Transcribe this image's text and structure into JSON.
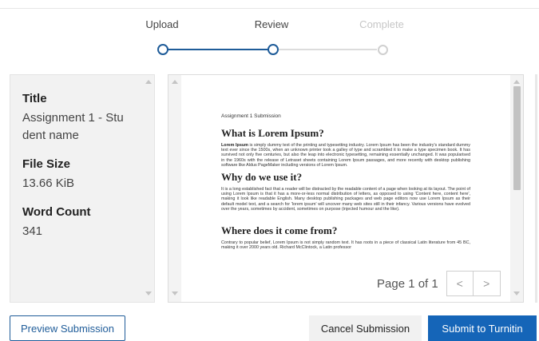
{
  "steps": [
    {
      "label": "Upload",
      "state": "done"
    },
    {
      "label": "Review",
      "state": "current"
    },
    {
      "label": "Complete",
      "state": "todo"
    }
  ],
  "info": {
    "title_label": "Title",
    "title_value": "Assignment 1 - Student name",
    "size_label": "File Size",
    "size_value": "13.66 KiB",
    "words_label": "Word Count",
    "words_value": "341"
  },
  "document": {
    "header": "Assignment 1 Submission",
    "h1": "What is Lorem Ipsum?",
    "p1_bold": "Lorem Ipsum",
    "p1": " is simply dummy text of the printing and typesetting industry. Lorem Ipsum has been the industry's standard dummy text ever since the 1500s, when an unknown printer took a galley of type and scrambled it to make a type specimen book. It has survived not only five centuries, but also the leap into electronic typesetting, remaining essentially unchanged. It was popularised in the 1960s with the release of Letraset sheets containing Lorem Ipsum passages, and more recently with desktop publishing software like Aldus PageMaker including versions of Lorem Ipsum.",
    "h2": "Why do we use it?",
    "p2": "It is a long established fact that a reader will be distracted by the readable content of a page when looking at its layout. The point of using Lorem Ipsum is that it has a more-or-less normal distribution of letters, as opposed to using 'Content here, content here', making it look like readable English. Many desktop publishing packages and web page editors now use Lorem Ipsum as their default model text, and a search for 'lorem ipsum' will uncover many web sites still in their infancy. Various versions have evolved over the years, sometimes by accident, sometimes on purpose (injected humour and the like).",
    "h3": "Where does it come from?",
    "p3": "Contrary to popular belief, Lorem Ipsum is not simply random text. It has roots in a piece of classical Latin literature from 45 BC, making it over 2000 years old. Richard McClintock, a Latin professor"
  },
  "pager": {
    "text": "Page 1 of 1",
    "prev": "<",
    "next": ">"
  },
  "buttons": {
    "preview": "Preview Submission",
    "cancel": "Cancel Submission",
    "submit": "Submit to Turnitin"
  },
  "colors": {
    "accent": "#1565b8",
    "step_done": "#1f5c99",
    "step_todo": "#d0d0d0"
  }
}
